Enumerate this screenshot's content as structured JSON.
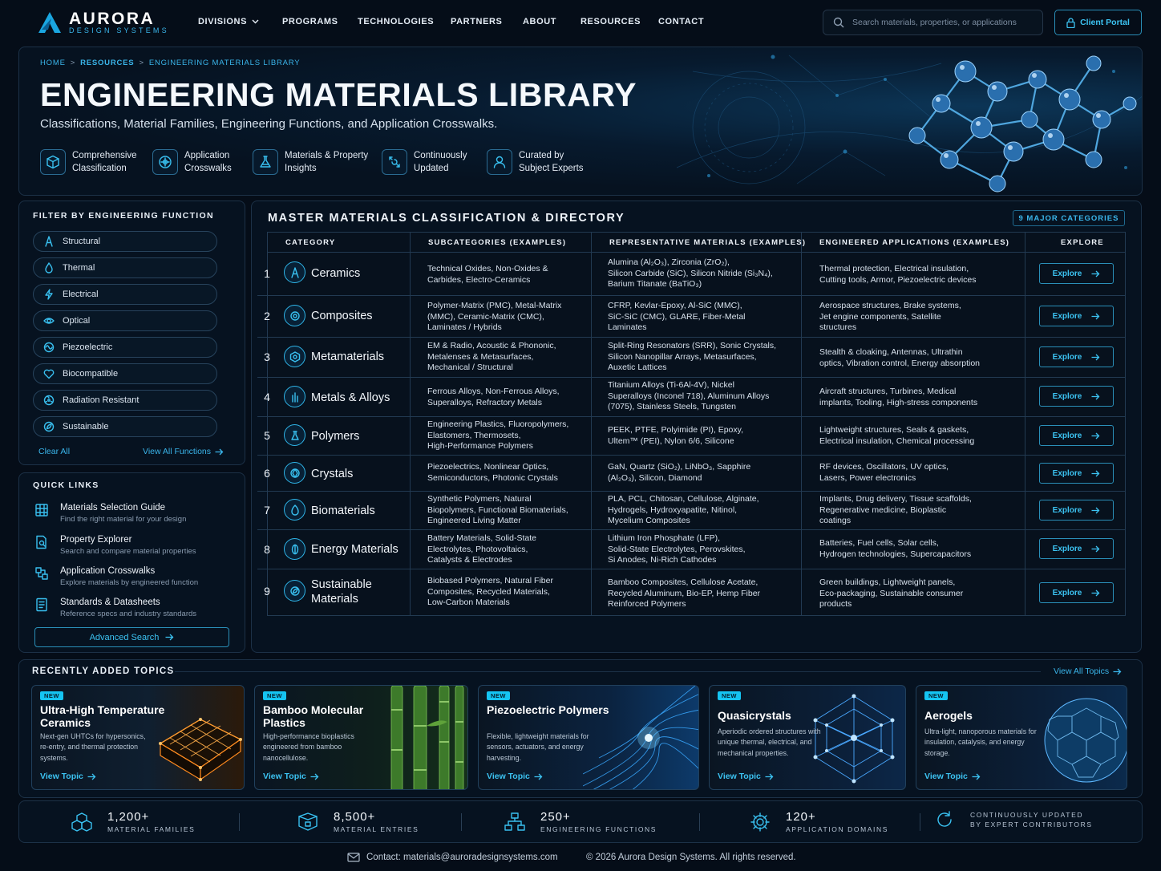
{
  "brand": {
    "name": "AURORA",
    "tagline": "DESIGN SYSTEMS"
  },
  "nav": {
    "items": [
      "DIVISIONS",
      "PROGRAMS",
      "TECHNOLOGIES",
      "PARTNERS",
      "ABOUT",
      "RESOURCES",
      "CONTACT"
    ],
    "search_placeholder": "Search materials, properties, or applications",
    "portal_label": "Client Portal"
  },
  "hero": {
    "breadcrumb": [
      "HOME",
      "RESOURCES",
      "ENGINEERING MATERIALS LIBRARY"
    ],
    "breadcrumb_sep": ">",
    "title": "ENGINEERING MATERIALS LIBRARY",
    "subtitle": "Classifications, Material Families, Engineering Functions, and Application Crosswalks.",
    "features": [
      {
        "line1": "Comprehensive",
        "line2": "Classification",
        "icon": "cube-icon"
      },
      {
        "line1": "Application",
        "line2": "Crosswalks",
        "icon": "crosswalk-icon"
      },
      {
        "line1": "Materials & Property",
        "line2": "Insights",
        "icon": "flask-icon"
      },
      {
        "line1": "Continuously",
        "line2": "Updated",
        "icon": "refresh-icon"
      },
      {
        "line1": "Curated by",
        "line2": "Subject Experts",
        "icon": "user-icon"
      }
    ]
  },
  "filter": {
    "title": "FILTER BY ENGINEERING FUNCTION",
    "items": [
      "Structural",
      "Thermal",
      "Electrical",
      "Optical",
      "Piezoelectric",
      "Biocompatible",
      "Radiation Resistant",
      "Sustainable"
    ],
    "clear_label": "Clear All",
    "view_all_label": "View All Functions"
  },
  "quick_links": {
    "title": "QUICK LINKS",
    "items": [
      {
        "title": "Materials Selection Guide",
        "desc": "Find the right material for your design"
      },
      {
        "title": "Property Explorer",
        "desc": "Search and compare material properties"
      },
      {
        "title": "Application Crosswalks",
        "desc": "Explore materials by engineered function"
      },
      {
        "title": "Standards & Datasheets",
        "desc": "Reference specs and industry standards"
      }
    ],
    "advanced_label": "Advanced Search"
  },
  "directory": {
    "title": "MASTER MATERIALS CLASSIFICATION & DIRECTORY",
    "badge": "9 MAJOR CATEGORIES",
    "columns": [
      "CATEGORY",
      "SUBCATEGORIES (EXAMPLES)",
      "REPRESENTATIVE MATERIALS (EXAMPLES)",
      "ENGINEERED APPLICATIONS (EXAMPLES)",
      "EXPLORE"
    ],
    "explore_label": "Explore",
    "rows": [
      {
        "num": "1",
        "name": "Ceramics",
        "sub": [
          "Technical Oxides, Non-Oxides &",
          "Carbides, Electro-Ceramics"
        ],
        "mat": [
          "Alumina (Al₂O₃), Zirconia (ZrO₂),",
          "Silicon Carbide (SiC), Silicon Nitride (Si₃N₄),",
          "Barium Titanate (BaTiO₃)"
        ],
        "app": [
          "Thermal protection, Electrical insulation,",
          "Cutting tools, Armor, Piezoelectric devices"
        ]
      },
      {
        "num": "2",
        "name": "Composites",
        "sub": [
          "Polymer-Matrix (PMC), Metal-Matrix",
          "(MMC), Ceramic-Matrix (CMC),",
          "Laminates / Hybrids"
        ],
        "mat": [
          "CFRP, Kevlar-Epoxy, Al-SiC (MMC),",
          "SiC-SiC (CMC), GLARE, Fiber-Metal",
          "Laminates"
        ],
        "app": [
          "Aerospace structures, Brake systems,",
          "Jet engine components, Satellite",
          "structures"
        ]
      },
      {
        "num": "3",
        "name": "Metamaterials",
        "sub": [
          "EM & Radio, Acoustic & Phononic,",
          "Metalenses & Metasurfaces,",
          "Mechanical / Structural"
        ],
        "mat": [
          "Split-Ring Resonators (SRR), Sonic Crystals,",
          "Silicon Nanopillar Arrays, Metasurfaces,",
          "Auxetic Lattices"
        ],
        "app": [
          "Stealth & cloaking, Antennas, Ultrathin",
          "optics, Vibration control, Energy absorption"
        ]
      },
      {
        "num": "4",
        "name": "Metals & Alloys",
        "sub": [
          "Ferrous Alloys, Non-Ferrous Alloys,",
          "Superalloys, Refractory Metals"
        ],
        "mat": [
          "Titanium Alloys (Ti-6Al-4V), Nickel",
          "Superalloys (Inconel 718), Aluminum Alloys",
          "(7075), Stainless Steels, Tungsten"
        ],
        "app": [
          "Aircraft structures, Turbines, Medical",
          "implants, Tooling, High-stress components"
        ]
      },
      {
        "num": "5",
        "name": "Polymers",
        "sub": [
          "Engineering Plastics, Fluoropolymers,",
          "Elastomers, Thermosets,",
          "High-Performance Polymers"
        ],
        "mat": [
          "PEEK, PTFE, Polyimide (PI), Epoxy,",
          "Ultem™ (PEI), Nylon 6/6, Silicone"
        ],
        "app": [
          "Lightweight structures, Seals & gaskets,",
          "Electrical insulation, Chemical processing"
        ]
      },
      {
        "num": "6",
        "name": "Crystals",
        "sub": [
          "Piezoelectrics, Nonlinear Optics,",
          "Semiconductors, Photonic Crystals"
        ],
        "mat": [
          "GaN, Quartz (SiO₂), LiNbO₃, Sapphire",
          "(Al₂O₃), Silicon, Diamond"
        ],
        "app": [
          "RF devices, Oscillators, UV optics,",
          "Lasers, Power electronics"
        ]
      },
      {
        "num": "7",
        "name": "Biomaterials",
        "sub": [
          "Synthetic Polymers, Natural",
          "Biopolymers, Functional Biomaterials,",
          "Engineered Living Matter"
        ],
        "mat": [
          "PLA, PCL, Chitosan, Cellulose, Alginate,",
          "Hydrogels, Hydroxyapatite, Nitinol,",
          "Mycelium Composites"
        ],
        "app": [
          "Implants, Drug delivery, Tissue scaffolds,",
          "Regenerative medicine, Bioplastic",
          "coatings"
        ]
      },
      {
        "num": "8",
        "name": "Energy Materials",
        "sub": [
          "Battery Materials, Solid-State",
          "Electrolytes, Photovoltaics,",
          "Catalysts & Electrodes"
        ],
        "mat": [
          "Lithium Iron Phosphate (LFP),",
          "Solid-State Electrolytes, Perovskites,",
          "Si Anodes, Ni-Rich Cathodes"
        ],
        "app": [
          "Batteries, Fuel cells, Solar cells,",
          "Hydrogen technologies, Supercapacitors"
        ]
      },
      {
        "num": "9",
        "name": "Sustainable Materials",
        "sub": [
          "Biobased Polymers, Natural Fiber",
          "Composites, Recycled Materials,",
          "Low-Carbon Materials"
        ],
        "mat": [
          "Bamboo Composites, Cellulose Acetate,",
          "Recycled Aluminum, Bio-EP, Hemp Fiber",
          "Reinforced Polymers"
        ],
        "app": [
          "Green buildings, Lightweight panels,",
          "Eco-packaging, Sustainable consumer",
          "products"
        ]
      }
    ]
  },
  "recent": {
    "title": "RECENTLY ADDED TOPICS",
    "view_all_label": "View All Topics",
    "badge": "NEW",
    "link_label": "View Topic",
    "cards": [
      {
        "title": "Ultra-High Temperature Ceramics",
        "desc": "Next-gen UHTCs for hypersonics, re-entry, and thermal protection systems."
      },
      {
        "title": "Bamboo Molecular Plastics",
        "desc": "High-performance bioplastics engineered from bamboo nanocellulose."
      },
      {
        "title": "Piezoelectric Polymers",
        "desc": "Flexible, lightweight materials for sensors, actuators, and energy harvesting."
      },
      {
        "title": "Quasicrystals",
        "desc": "Aperiodic ordered structures with unique thermal, electrical, and mechanical properties."
      },
      {
        "title": "Aerogels",
        "desc": "Ultra-light, nanoporous materials for insulation, catalysis, and energy storage."
      }
    ]
  },
  "stats": [
    {
      "value": "1,200+",
      "label": "MATERIAL FAMILIES"
    },
    {
      "value": "8,500+",
      "label": "MATERIAL ENTRIES"
    },
    {
      "value": "250+",
      "label": "ENGINEERING FUNCTIONS"
    },
    {
      "value": "120+",
      "label": "APPLICATION DOMAINS"
    },
    {
      "value": "",
      "label": "CONTINUOUSLY UPDATED",
      "label2": "BY EXPERT CONTRIBUTORS"
    }
  ],
  "footer": {
    "contact": "Contact: materials@auroradesignsystems.com",
    "copyright": "© 2026 Aurora Design Systems. All rights reserved."
  },
  "colors": {
    "accent": "#3cc3f2",
    "background": "#050d18",
    "panel": "#061220",
    "border": "#1c3147"
  }
}
